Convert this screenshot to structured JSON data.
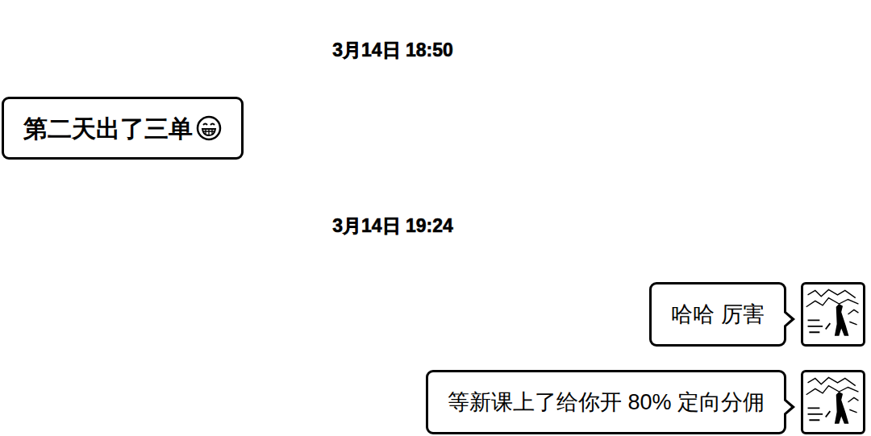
{
  "messages": [
    {
      "kind": "time",
      "text": "3月14日 18:50"
    },
    {
      "kind": "incoming",
      "text": "第二天出了三单"
    },
    {
      "kind": "time",
      "text": "3月14日 19:24"
    },
    {
      "kind": "outgoing",
      "text": "哈哈 厉害"
    },
    {
      "kind": "outgoing",
      "text": "等新课上了给你开 80% 定向分佣"
    }
  ]
}
